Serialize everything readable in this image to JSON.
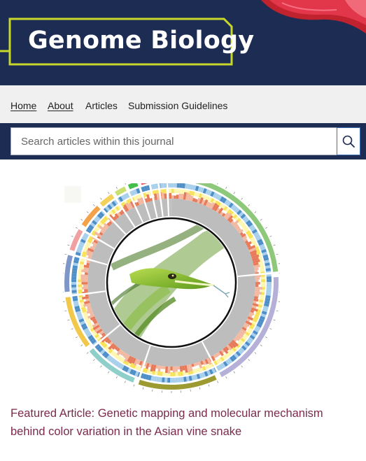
{
  "header": {
    "journal_title": "Genome Biology",
    "accent_color": "#c8d82a",
    "background_color": "#1d2c53"
  },
  "nav": {
    "items": [
      {
        "label": "Home"
      },
      {
        "label": "About"
      },
      {
        "label": "Articles"
      },
      {
        "label": "Submission Guidelines"
      }
    ]
  },
  "search": {
    "placeholder": "Search articles within this journal",
    "button_icon": "search-icon"
  },
  "featured": {
    "link_text": "Featured Article: Genetic mapping and molecular mechanism behind color variation in the Asian vine snake",
    "link_color": "#7b2a4c",
    "image_icon": "circos-genome-plot-with-vine-snake"
  }
}
